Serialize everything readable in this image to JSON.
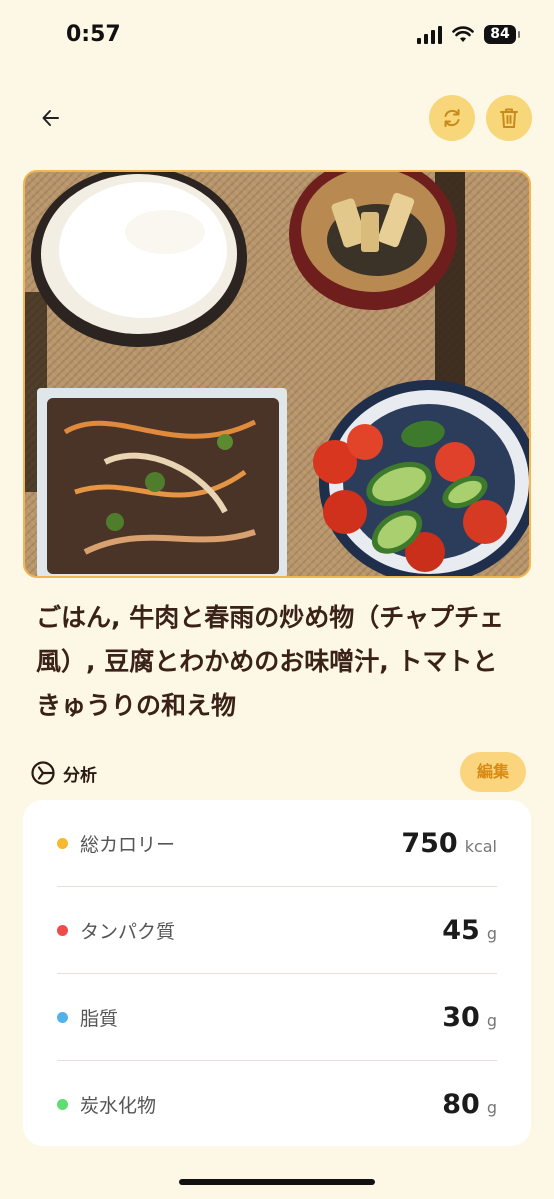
{
  "status_bar": {
    "time": "0:57",
    "battery": "84"
  },
  "nav": {
    "back_icon": "arrow-left-icon",
    "refresh_icon": "refresh-icon",
    "delete_icon": "trash-icon"
  },
  "meal": {
    "photo_icon": "meal-photo",
    "title": "ごはん, 牛肉と春雨の炒め物（チャプチェ風）, 豆腐とわかめのお味噌汁, トマトときゅうりの和え物"
  },
  "analysis": {
    "icon": "pie-chart-icon",
    "label": "分析",
    "edit_label": "編集"
  },
  "nutrition": [
    {
      "name": "総カロリー",
      "value": "750",
      "unit": "kcal",
      "color": "#f5b82e"
    },
    {
      "name": "タンパク質",
      "value": "45",
      "unit": "g",
      "color": "#ee4b4b"
    },
    {
      "name": "脂質",
      "value": "30",
      "unit": "g",
      "color": "#52b3ea"
    },
    {
      "name": "炭水化物",
      "value": "80",
      "unit": "g",
      "color": "#5fdc72"
    }
  ],
  "colors": {
    "accent": "#f8d77a",
    "background": "#fdf7e6",
    "photo_border": "#f3b550"
  }
}
